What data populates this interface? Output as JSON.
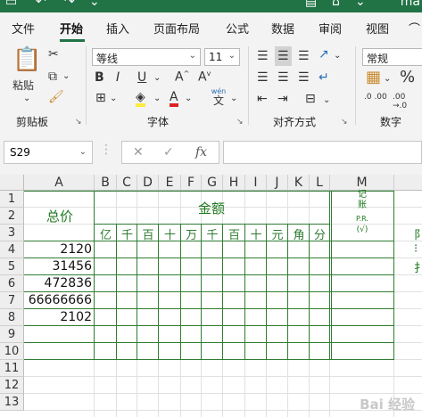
{
  "window": {
    "title_fragment": "ma"
  },
  "tabs": [
    {
      "label": "文件",
      "active": false
    },
    {
      "label": "开始",
      "active": true
    },
    {
      "label": "插入",
      "active": false
    },
    {
      "label": "页面布局",
      "active": false
    },
    {
      "label": "公式",
      "active": false
    },
    {
      "label": "数据",
      "active": false
    },
    {
      "label": "审阅",
      "active": false
    },
    {
      "label": "视图",
      "active": false
    }
  ],
  "ribbon": {
    "clipboard": {
      "paste_label": "粘贴",
      "group_label": "剪贴板"
    },
    "font": {
      "font_name": "等线",
      "font_size": "11",
      "group_label": "字体",
      "phonetic_top": "wén",
      "phonetic_bottom": "文"
    },
    "alignment": {
      "group_label": "对齐方式"
    },
    "number": {
      "format": "常规",
      "group_label": "数字",
      "percent": "%",
      "dec_increase": ".0 .00",
      "dec_decrease": ".00 →.0"
    }
  },
  "formula_bar": {
    "name_box": "S29",
    "fx_label": "fx",
    "value": ""
  },
  "columns": [
    "A",
    "B",
    "C",
    "D",
    "E",
    "F",
    "G",
    "H",
    "I",
    "J",
    "K",
    "L",
    "M"
  ],
  "rows": [
    "1",
    "2",
    "3",
    "4",
    "5",
    "6",
    "7",
    "8",
    "9",
    "10",
    "11",
    "12",
    "13"
  ],
  "sheet": {
    "total_header": "总价",
    "amount_header": "金额",
    "ledger_top": "记",
    "ledger_mid": "账",
    "ledger_pr": "P.R.",
    "ledger_check": "(√)",
    "digit_labels": [
      "亿",
      "千",
      "百",
      "十",
      "万",
      "千",
      "百",
      "十",
      "元",
      "角",
      "分"
    ],
    "values": [
      "2120",
      "31456",
      "472836",
      "66666666",
      "2102"
    ],
    "partial_right_chars": [
      "阝",
      "⁝",
      "扌"
    ]
  },
  "watermark": "Bai 经验",
  "colors": {
    "excel_green": "#217346",
    "border_green": "#2f7d32",
    "text_green": "#1f7a1f"
  }
}
